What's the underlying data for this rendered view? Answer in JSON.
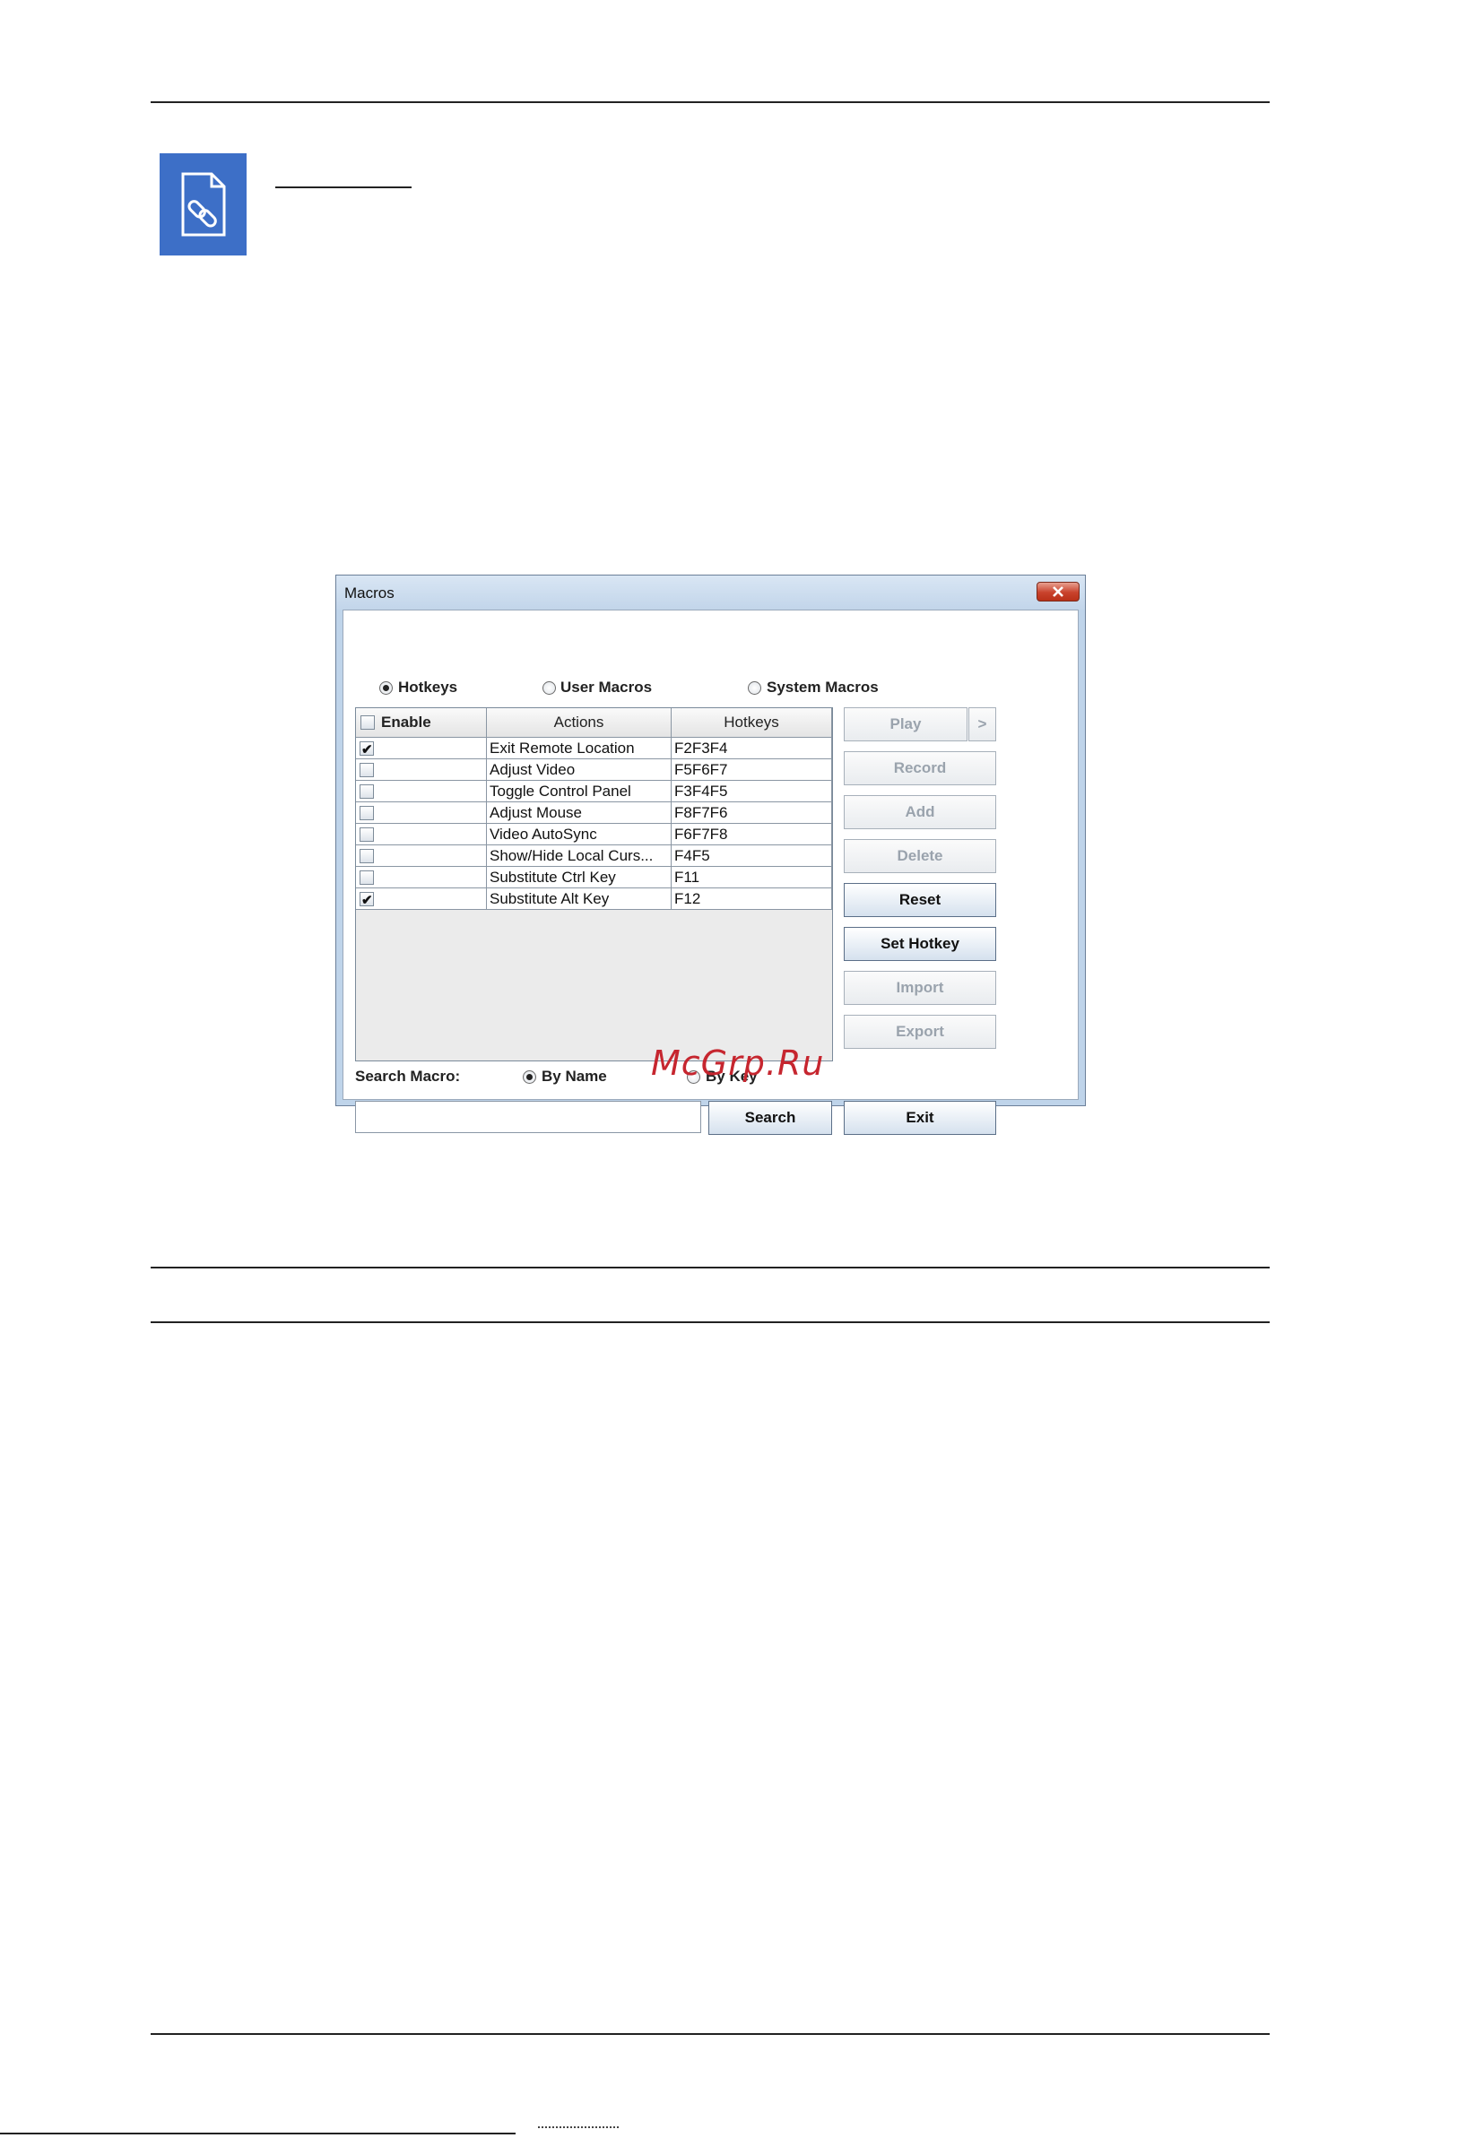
{
  "page": {
    "icon_name": "linked-document-icon"
  },
  "dialog": {
    "title": "Macros",
    "tabs": [
      {
        "label": "Hotkeys",
        "selected": true
      },
      {
        "label": "User Macros",
        "selected": false
      },
      {
        "label": "System Macros",
        "selected": false
      }
    ],
    "table": {
      "headers": {
        "enable": "Enable",
        "actions": "Actions",
        "hotkeys": "Hotkeys"
      },
      "rows": [
        {
          "enabled": true,
          "action": "Exit Remote Location",
          "hotkey": "F2F3F4"
        },
        {
          "enabled": false,
          "action": "Adjust Video",
          "hotkey": "F5F6F7"
        },
        {
          "enabled": false,
          "action": "Toggle Control Panel",
          "hotkey": "F3F4F5"
        },
        {
          "enabled": false,
          "action": "Adjust Mouse",
          "hotkey": "F8F7F6"
        },
        {
          "enabled": false,
          "action": "Video AutoSync",
          "hotkey": "F6F7F8"
        },
        {
          "enabled": false,
          "action": "Show/Hide Local Curs...",
          "hotkey": "F4F5"
        },
        {
          "enabled": false,
          "action": "Substitute Ctrl Key",
          "hotkey": "F11"
        },
        {
          "enabled": true,
          "action": "Substitute Alt Key",
          "hotkey": "F12"
        }
      ]
    },
    "buttons": {
      "play": "Play",
      "play_more": ">",
      "record": "Record",
      "add": "Add",
      "delete": "Delete",
      "reset": "Reset",
      "set_hotkey": "Set Hotkey",
      "import": "Import",
      "export": "Export",
      "exit": "Exit",
      "search": "Search"
    },
    "search": {
      "label": "Search Macro:",
      "by_name": "By Name",
      "by_key": "By Key",
      "mode_selected": "By Name",
      "value": ""
    }
  },
  "watermark": "McGrp.Ru"
}
